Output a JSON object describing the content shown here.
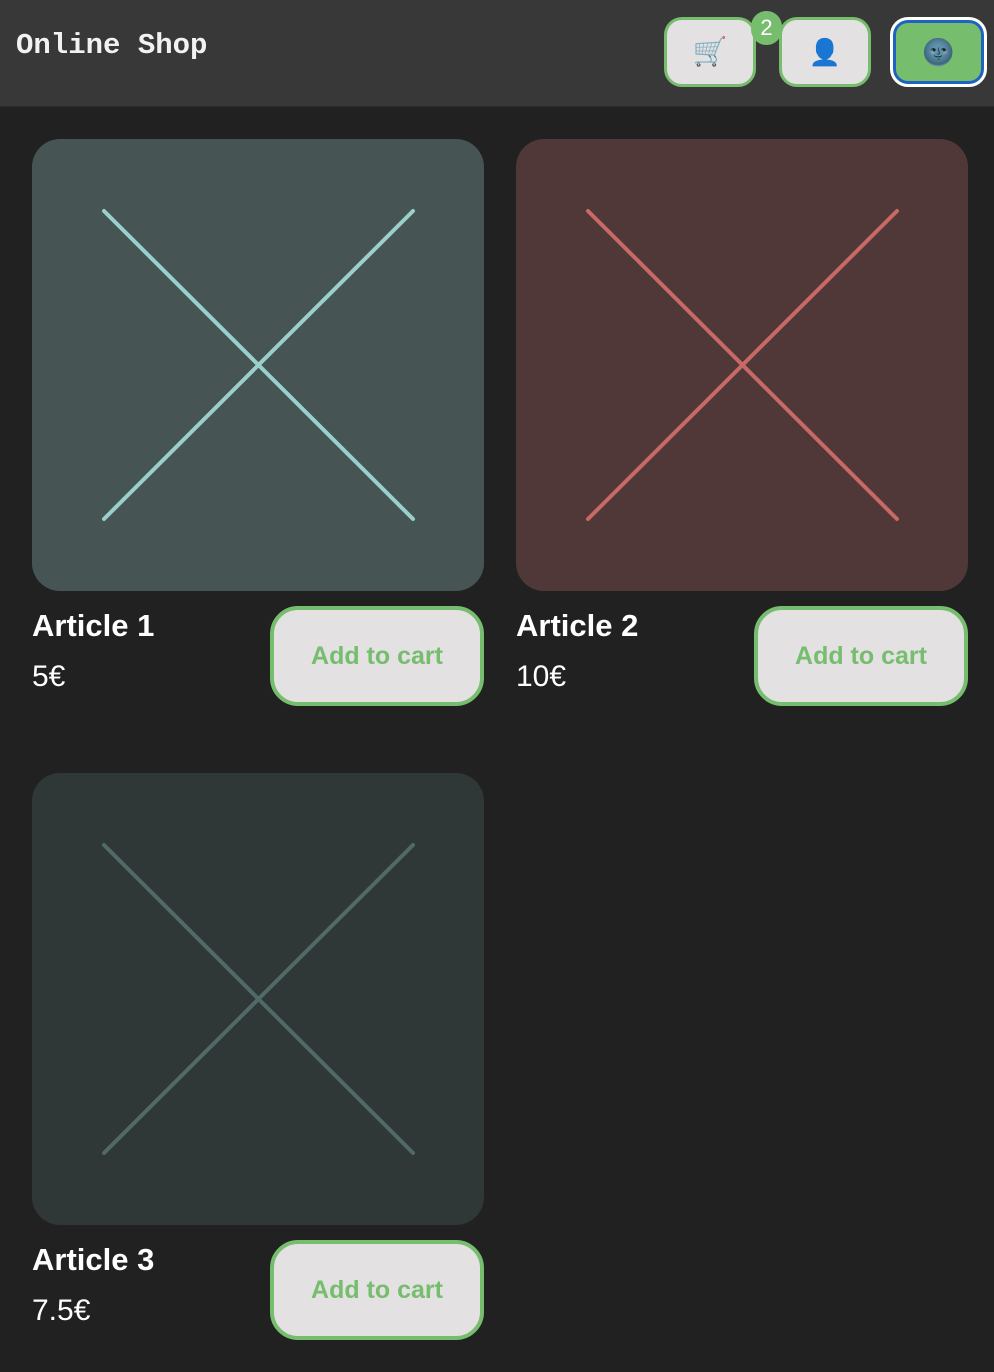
{
  "header": {
    "title": "Online Shop",
    "cart_icon": "🛒",
    "cart_count": "2",
    "user_icon": "👤",
    "theme_icon": "🌚"
  },
  "colors": {
    "background": "#212121",
    "header_bg": "#383838",
    "accent": "#76bd6e",
    "button_bg": "#e3e1e2",
    "focus_ring": "#1f63c2"
  },
  "products": [
    {
      "name": "Article 1",
      "price": "5€",
      "button_label": "Add to cart",
      "image_icon": "placeholder-x-icon",
      "image_bg": "#465454",
      "image_line": "#9ad0cc"
    },
    {
      "name": "Article 2",
      "price": "10€",
      "button_label": "Add to cart",
      "image_icon": "placeholder-x-icon",
      "image_bg": "#503838",
      "image_line": "#c76964"
    },
    {
      "name": "Article 3",
      "price": "7.5€",
      "button_label": "Add to cart",
      "image_icon": "placeholder-x-icon",
      "image_bg": "#2f3737",
      "image_line": "#506a68"
    }
  ]
}
